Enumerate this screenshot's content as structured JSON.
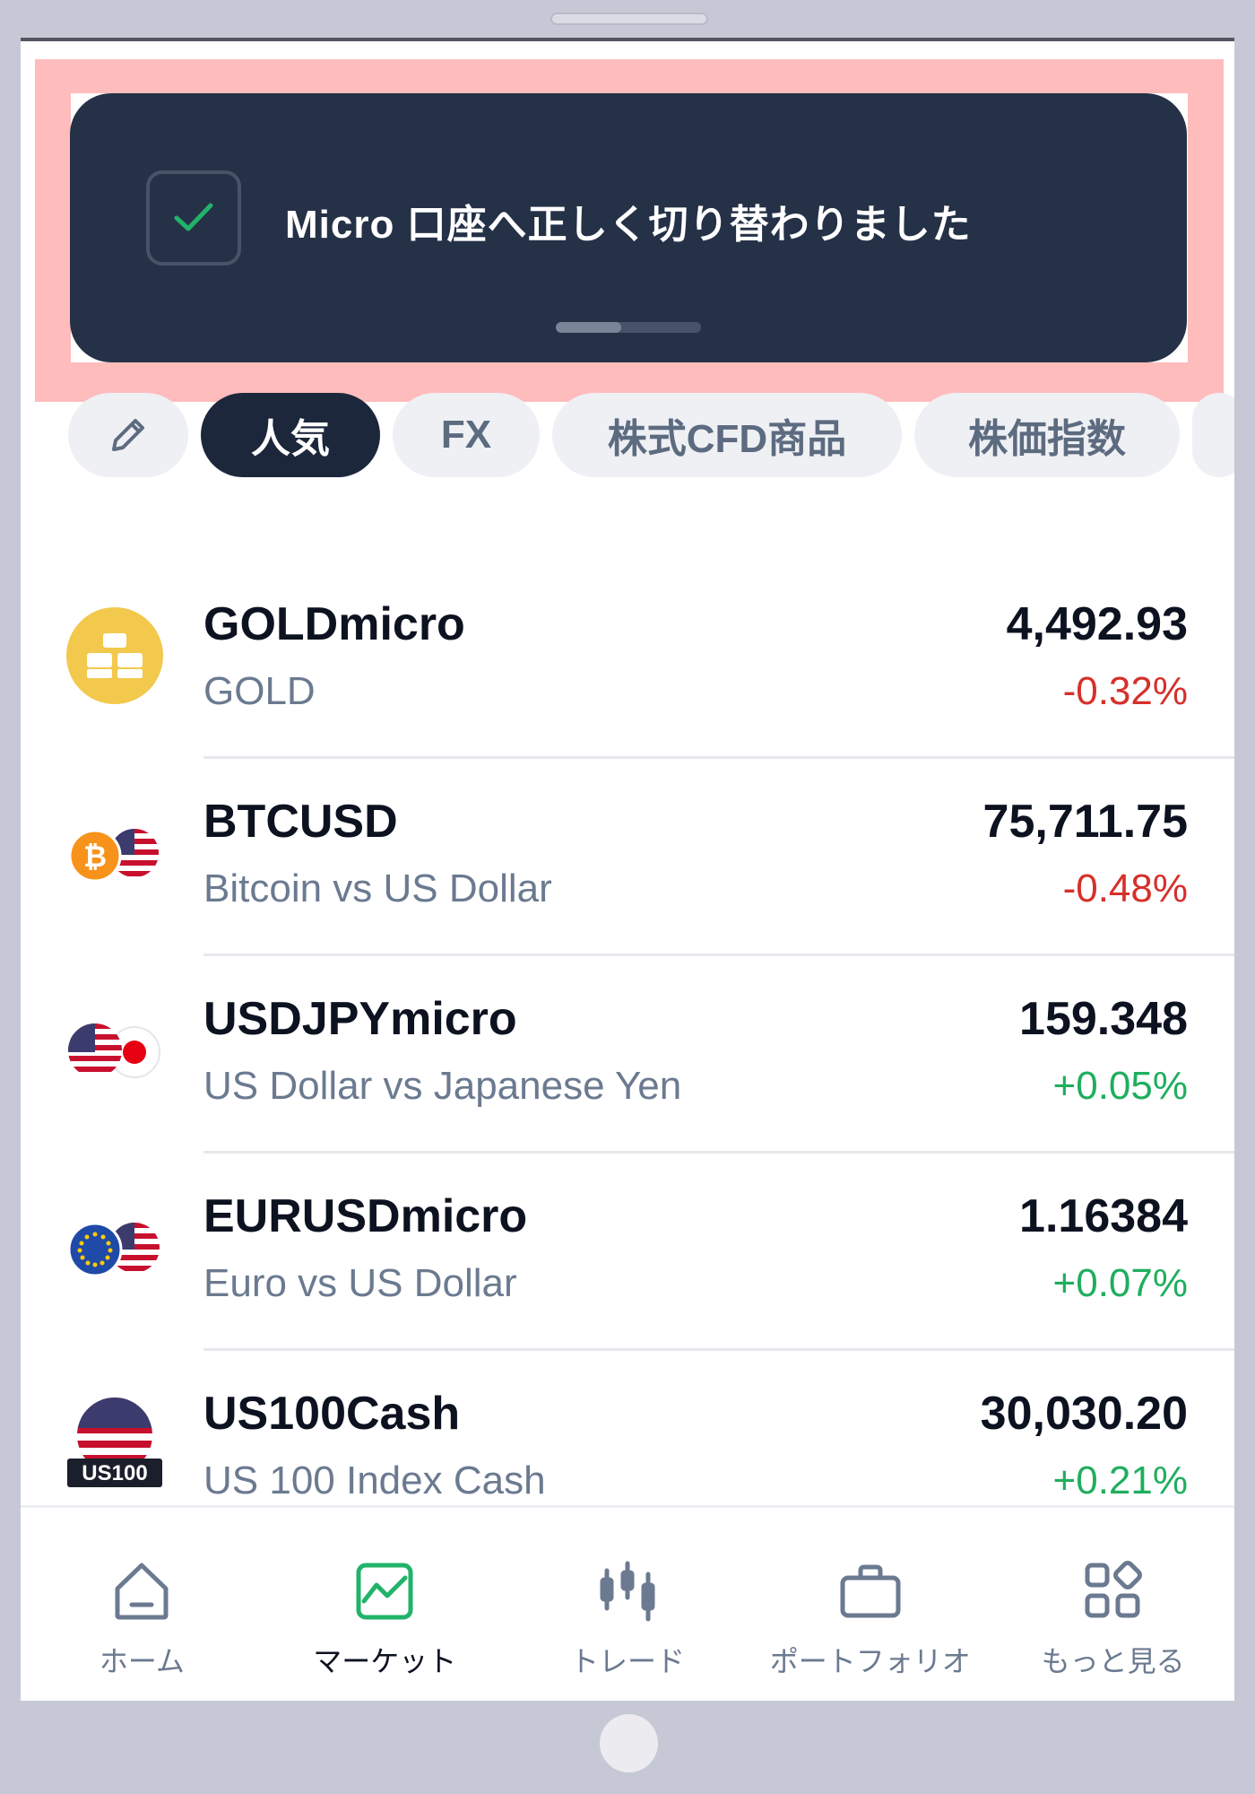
{
  "toast": {
    "message": "Micro 口座へ正しく切り替わりました",
    "progress": 0.45
  },
  "categories": {
    "items": [
      {
        "label": "",
        "icon": "pencil-icon"
      },
      {
        "label": "人気",
        "active": true
      },
      {
        "label": "FX"
      },
      {
        "label": "株式CFD商品"
      },
      {
        "label": "株価指数"
      }
    ]
  },
  "instruments": [
    {
      "symbol": "GOLDmicro",
      "description": "GOLD",
      "price": "4,492.93",
      "change": "-0.32%",
      "direction": "down",
      "icon": "gold-bars-icon"
    },
    {
      "symbol": "BTCUSD",
      "description": "Bitcoin vs US Dollar",
      "price": "75,711.75",
      "change": "-0.48%",
      "direction": "down",
      "icon": "bitcoin-usd-flag-icon"
    },
    {
      "symbol": "USDJPYmicro",
      "description": "US Dollar vs Japanese Yen",
      "price": "159.348",
      "change": "+0.05%",
      "direction": "up",
      "icon": "usd-jpy-flag-icon"
    },
    {
      "symbol": "EURUSDmicro",
      "description": "Euro vs US Dollar",
      "price": "1.16384",
      "change": "+0.07%",
      "direction": "up",
      "icon": "eur-usd-flag-icon"
    },
    {
      "symbol": "US100Cash",
      "description": "US 100 Index Cash",
      "price": "30,030.20",
      "change": "+0.21%",
      "direction": "up",
      "icon": "us100-flag-icon",
      "badge": "US100"
    }
  ],
  "nav": {
    "items": [
      {
        "label": "ホーム",
        "icon": "home-icon"
      },
      {
        "label": "マーケット",
        "icon": "market-chart-icon",
        "active": true
      },
      {
        "label": "トレード",
        "icon": "candlestick-icon"
      },
      {
        "label": "ポートフォリオ",
        "icon": "briefcase-icon"
      },
      {
        "label": "もっと見る",
        "icon": "grid-more-icon"
      }
    ]
  },
  "colors": {
    "toast_bg": "#253147",
    "active_pill": "#1c273c",
    "negative": "#d6302b",
    "positive": "#1fae5f",
    "accent_green": "#21b36a",
    "highlight": "#ffbcbc"
  }
}
